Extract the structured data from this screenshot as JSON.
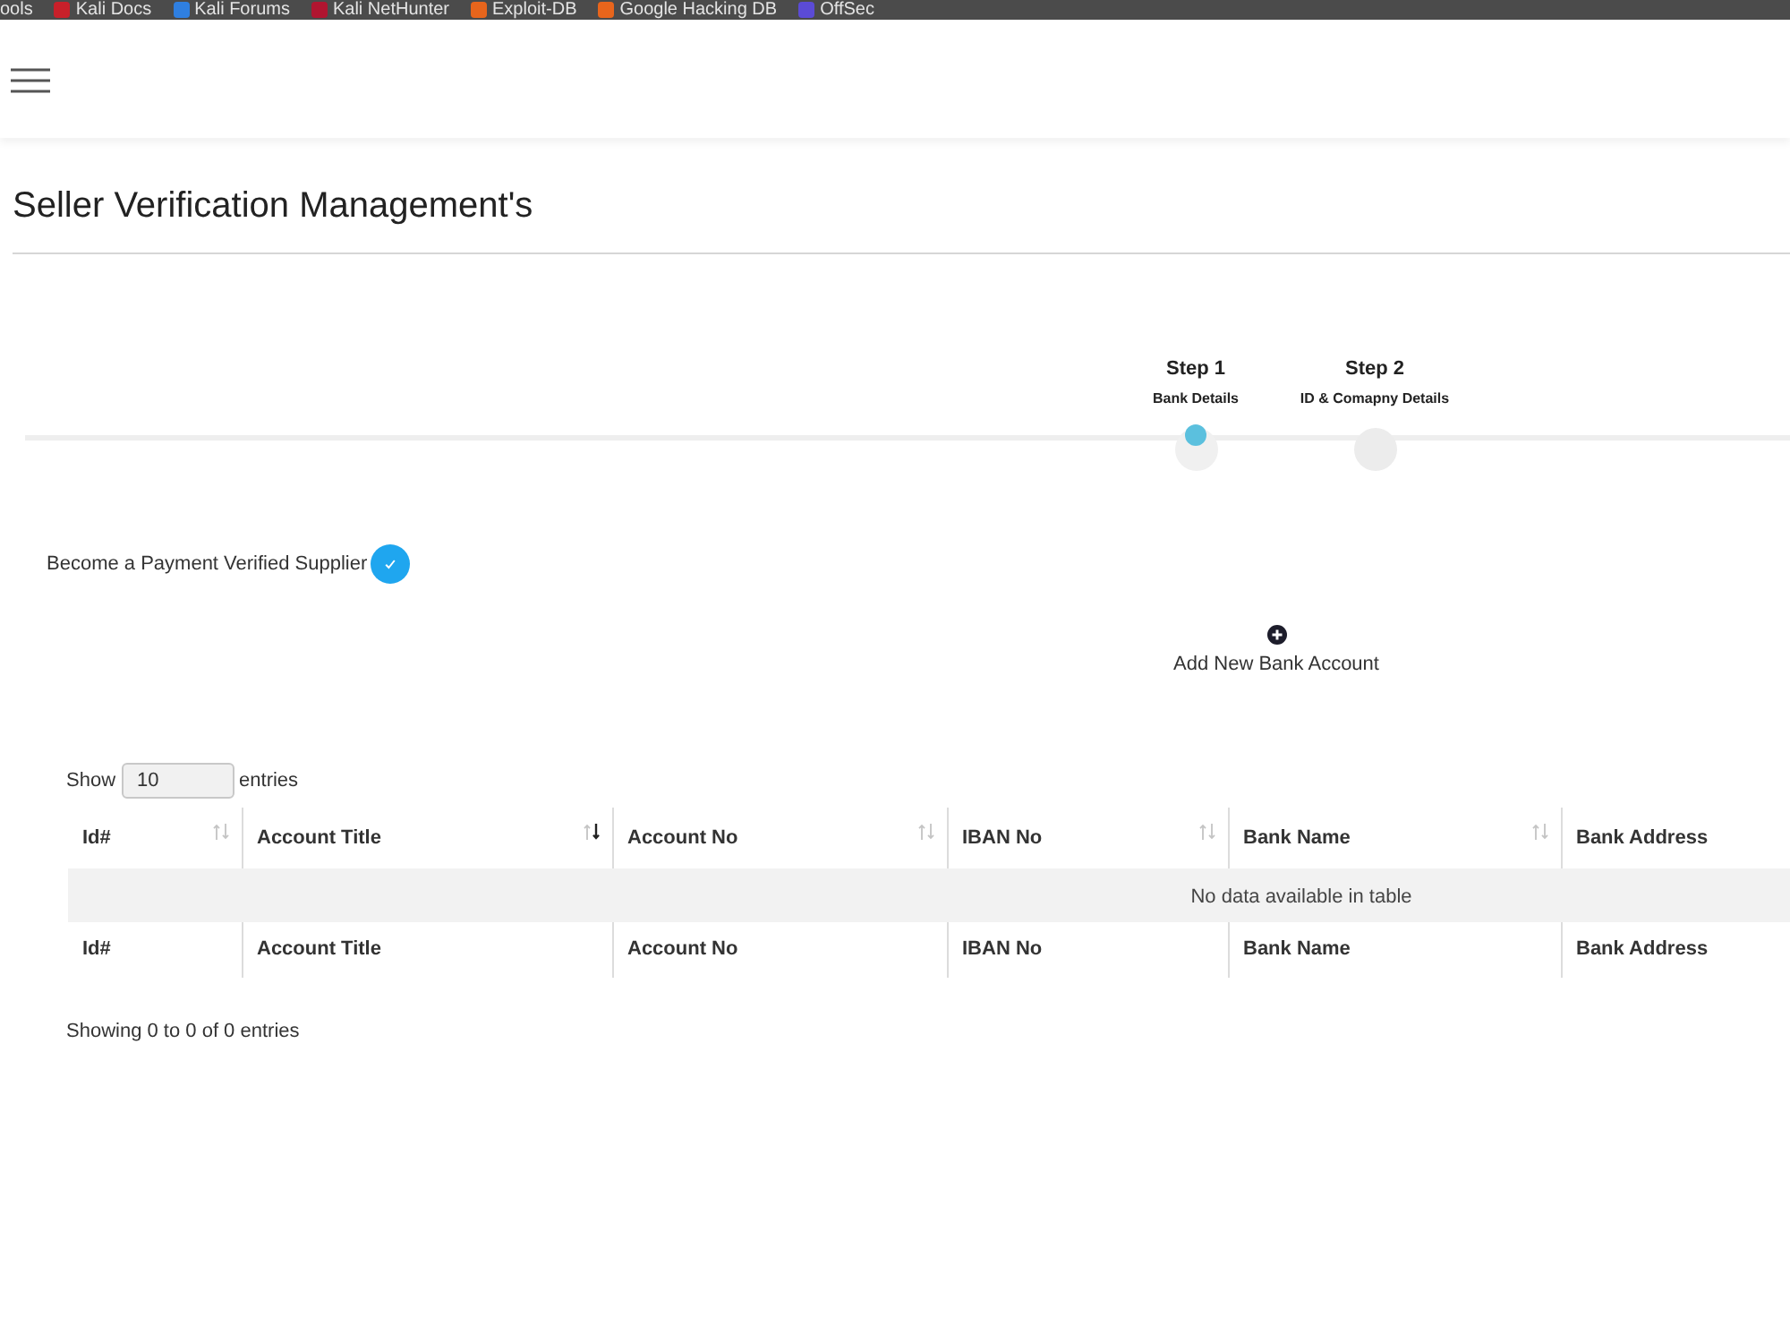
{
  "bookmarks_bar": {
    "items": [
      {
        "label": "ools"
      },
      {
        "label": "Kali Docs",
        "color": "#c8202a"
      },
      {
        "label": "Kali Forums",
        "color": "#2f7fe0"
      },
      {
        "label": "Kali NetHunter",
        "color": "#b01530"
      },
      {
        "label": "Exploit-DB",
        "color": "#e8651c"
      },
      {
        "label": "Google Hacking DB",
        "color": "#e8651c"
      },
      {
        "label": "OffSec",
        "color": "#5b4bd6"
      }
    ]
  },
  "page": {
    "title": "Seller Verification Management's"
  },
  "steps": [
    {
      "title": "Step 1",
      "subtitle": "Bank Details",
      "selected": true
    },
    {
      "title": "Step 2",
      "subtitle": "ID & Comapny Details",
      "selected": false
    }
  ],
  "verification": {
    "label": "Become a Payment Verified Supplier",
    "verified": true
  },
  "add_button": {
    "label": "Add New Bank Account"
  },
  "table": {
    "length": {
      "before": "Show",
      "value": "10",
      "after": "entries"
    },
    "columns": [
      {
        "label": "Id#",
        "sortable": true,
        "sorted": false
      },
      {
        "label": "Account Title",
        "sortable": true,
        "sorted": true
      },
      {
        "label": "Account No",
        "sortable": true,
        "sorted": false
      },
      {
        "label": "IBAN No",
        "sortable": true,
        "sorted": false
      },
      {
        "label": "Bank Name",
        "sortable": true,
        "sorted": false
      },
      {
        "label": "Bank Address",
        "sortable": false
      }
    ],
    "empty_message": "No data available in table",
    "footer": [
      "Id#",
      "Account Title",
      "Account No",
      "IBAN No",
      "Bank Name",
      "Bank Address"
    ],
    "info": "Showing 0 to 0 of 0 entries"
  }
}
